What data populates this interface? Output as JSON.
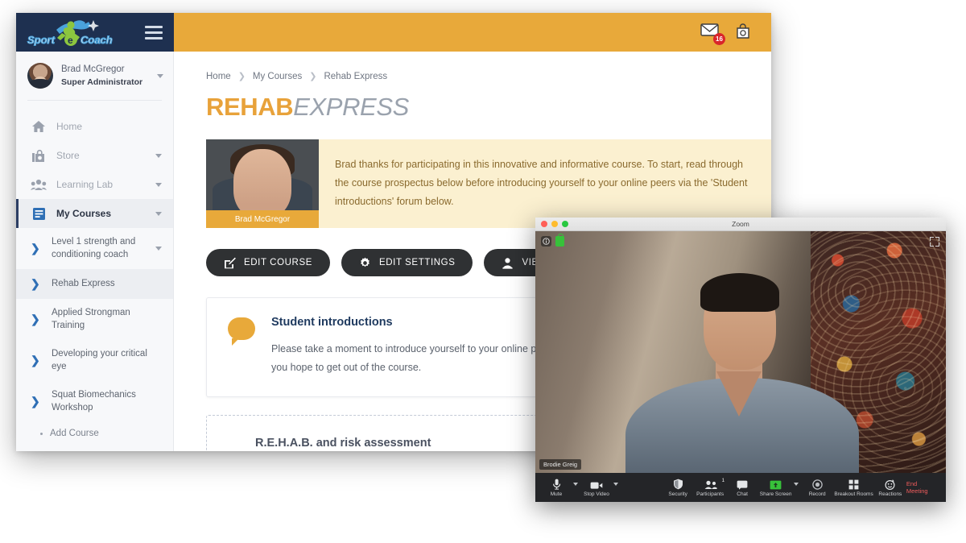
{
  "lms": {
    "brand": {
      "logo_text_1": "Sport",
      "logo_text_2": "e",
      "logo_text_3": "Coach",
      "menu_icon": "hamburger-icon"
    },
    "header": {
      "mail_icon": "envelope-icon",
      "mail_badge": "16",
      "store_icon": "shopping-bag-icon"
    },
    "user": {
      "name": "Brad McGregor",
      "role": "Super Administrator",
      "caret": "chevron-down-icon"
    },
    "nav": [
      {
        "label": "Home",
        "icon": "home-icon",
        "has_caret": false,
        "active": false
      },
      {
        "label": "Store",
        "icon": "store-icon",
        "has_caret": true,
        "active": false
      },
      {
        "label": "Learning Lab",
        "icon": "people-icon",
        "has_caret": true,
        "active": false
      },
      {
        "label": "My Courses",
        "icon": "book-icon",
        "has_caret": true,
        "active": true
      }
    ],
    "courses": [
      {
        "label": "Level 1 strength and conditioning coach",
        "selected": false,
        "has_caret": true
      },
      {
        "label": "Rehab Express",
        "selected": true,
        "has_caret": false
      },
      {
        "label": "Applied Strongman Training",
        "selected": false,
        "has_caret": false
      },
      {
        "label": "Developing your critical eye",
        "selected": false,
        "has_caret": false
      },
      {
        "label": "Squat Biomechanics Workshop",
        "selected": false,
        "has_caret": false
      }
    ],
    "add_course": "Add Course",
    "breadcrumbs": [
      "Home",
      "My Courses",
      "Rehab Express"
    ],
    "title": {
      "part1": "REHAB",
      "part2": "EXPRESS"
    },
    "welcome": {
      "photo_caption": "Brad McGregor",
      "text": "Brad thanks for participating in this innovative and informative course. To start, read through the course prospectus below before introducing yourself to your online peers via the 'Student introductions' forum below."
    },
    "buttons": [
      {
        "label": "EDIT COURSE",
        "icon": "pencil-square-icon"
      },
      {
        "label": "EDIT SETTINGS",
        "icon": "gear-icon"
      },
      {
        "label": "VIEW ENROLMENTS",
        "icon": "person-badge-icon"
      }
    ],
    "forum_card": {
      "icon": "speech-bubble-icon",
      "heading": "Student introductions",
      "body": "Please take a moment to introduce yourself to your online peers. Tell us about your background and what you hope to get out of the course."
    },
    "section_card": {
      "title": "R.E.H.A.B. and risk assessment"
    }
  },
  "zoom": {
    "window_title": "Zoom",
    "traffic_lights": [
      "close",
      "minimize",
      "maximize"
    ],
    "info_icon": "info-icon",
    "encryption_icon": "green-lock-icon",
    "fullscreen_icon": "expand-icon",
    "participant_name": "Brodie Greig",
    "toolbar": [
      {
        "label": "Mute",
        "icon": "microphone-icon",
        "caret": true,
        "count": ""
      },
      {
        "label": "Stop Video",
        "icon": "video-camera-icon",
        "caret": true,
        "count": ""
      },
      {
        "label": "Security",
        "icon": "shield-icon",
        "caret": false,
        "count": ""
      },
      {
        "label": "Participants",
        "icon": "people-icon",
        "caret": false,
        "count": "1"
      },
      {
        "label": "Chat",
        "icon": "chat-bubble-icon",
        "caret": false,
        "count": ""
      },
      {
        "label": "Share Screen",
        "icon": "share-screen-icon",
        "caret": true,
        "count": ""
      },
      {
        "label": "Record",
        "icon": "record-icon",
        "caret": false,
        "count": ""
      },
      {
        "label": "Breakout Rooms",
        "icon": "grid-icon",
        "caret": false,
        "count": ""
      },
      {
        "label": "Reactions",
        "icon": "reactions-icon",
        "caret": false,
        "count": ""
      }
    ],
    "end_meeting": "End Meeting"
  },
  "colors": {
    "navy": "#1e3050",
    "orange": "#e8a93a",
    "title_orange": "#e8a23a",
    "badge_red": "#d9252a",
    "dark_button": "#2f3133",
    "heading_blue": "#1f3a5f",
    "banner_bg": "#fbf0d0",
    "end_meeting_red": "#f05c5c",
    "share_green": "#37c13a"
  }
}
